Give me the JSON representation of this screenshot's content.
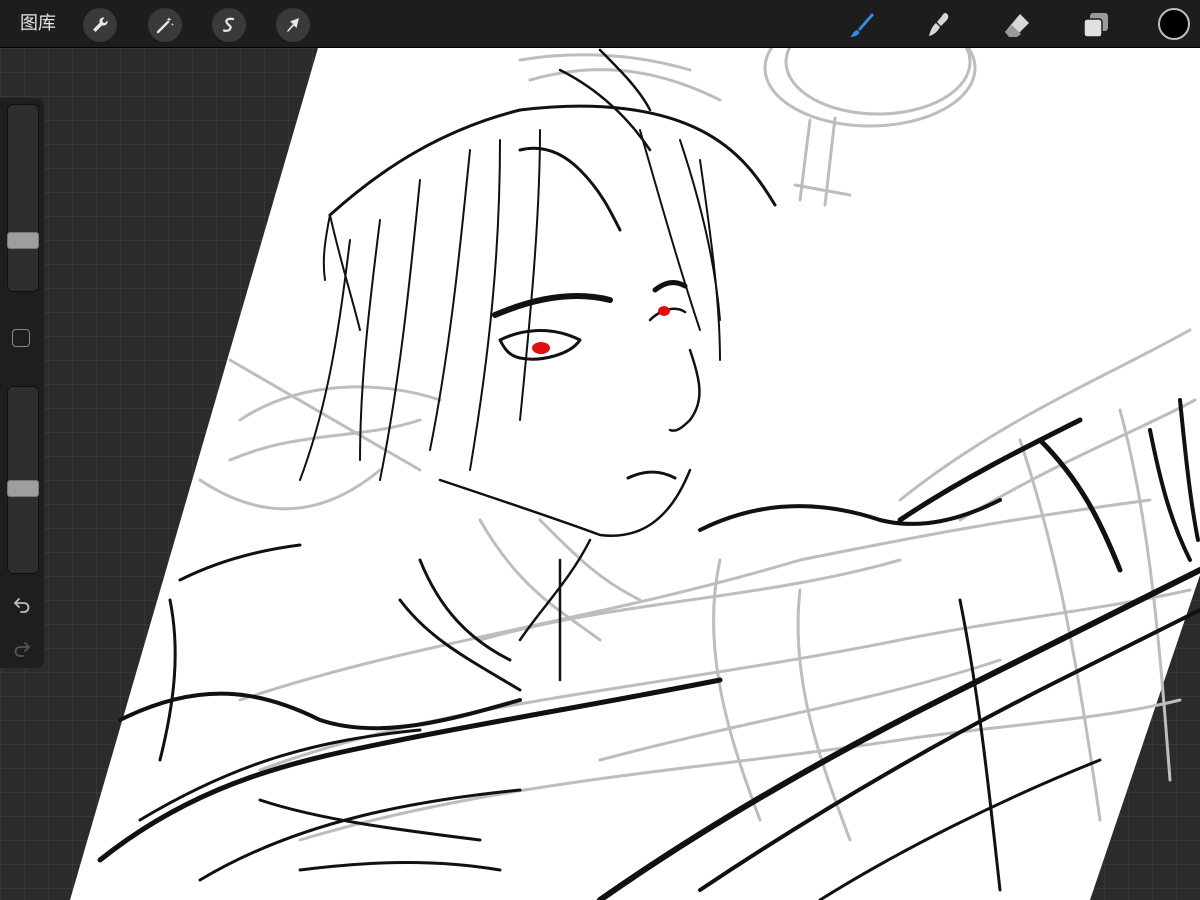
{
  "toolbar": {
    "gallery_label": "图库",
    "left_tools": [
      {
        "name": "wrench-icon",
        "label": "actions"
      },
      {
        "name": "magic-wand-icon",
        "label": "adjustments"
      },
      {
        "name": "selection-icon",
        "label": "selection"
      },
      {
        "name": "arrow-cursor-icon",
        "label": "transform"
      }
    ],
    "right_tools": [
      {
        "name": "brush-icon",
        "active": true
      },
      {
        "name": "smudge-icon",
        "active": false
      },
      {
        "name": "eraser-icon",
        "active": false
      },
      {
        "name": "layers-icon",
        "active": false
      }
    ],
    "current_color": "#000000",
    "accent_color": "#2f8fe8"
  },
  "sidebar": {
    "brush_size_level": 0.25,
    "opacity_level": 0.45,
    "icons": [
      "modifier-square-icon",
      "undo-icon",
      "redo-icon"
    ]
  },
  "canvas": {
    "content": "sketch-artwork",
    "eye_color": "#e01010"
  }
}
